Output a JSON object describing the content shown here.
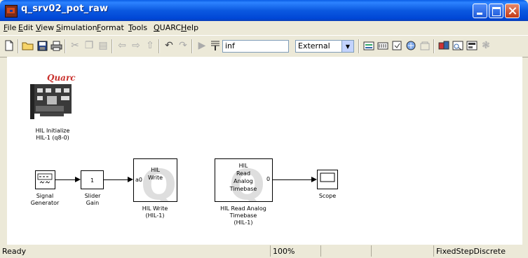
{
  "window": {
    "title": "q_srv02_pot_raw"
  },
  "menu": [
    "File",
    "Edit",
    "View",
    "Simulation",
    "Format",
    "Tools",
    "QUARC",
    "Help"
  ],
  "toolbar": {
    "stop_time": "inf",
    "sim_mode": "External"
  },
  "blocks": {
    "hil_init": {
      "brand": "Quarc",
      "label_line1": "HIL Initialize",
      "label_line2": "HIL-1 (q8-0)"
    },
    "signal_gen": {
      "label_line1": "Signal",
      "label_line2": "Generator"
    },
    "slider_gain": {
      "value": "1",
      "label_line1": "Slider",
      "label_line2": "Gain"
    },
    "hil_write": {
      "inner1": "HIL",
      "inner2": "Write",
      "port": "a0",
      "label_line1": "HIL Write",
      "label_line2": "(HIL-1)"
    },
    "hil_read": {
      "inner1": "HIL",
      "inner2": "Read",
      "inner3": "Analog",
      "inner4": "Timebase",
      "port": "0",
      "label_line1": "HIL Read Analog",
      "label_line2": "Timebase",
      "label_line3": "(HIL-1)"
    },
    "scope": {
      "label": "Scope"
    }
  },
  "status": {
    "left": "Ready",
    "zoom": "100%",
    "solver": "FixedStepDiscrete"
  }
}
